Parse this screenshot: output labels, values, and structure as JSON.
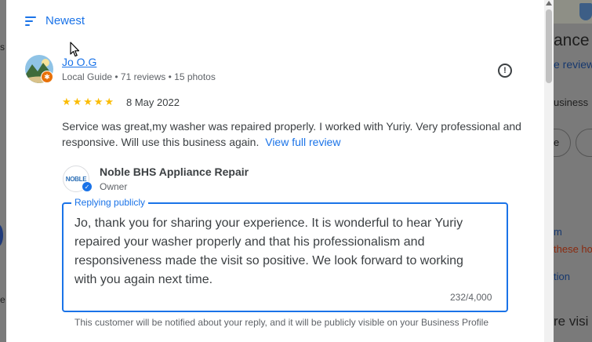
{
  "background": {
    "left_fragments": [
      "s",
      "e"
    ],
    "right_fragments": {
      "heading": "ance",
      "reviews_link": "e review",
      "category": "usiness",
      "pill_label": "e",
      "hours_link": "m",
      "hours_warning": "these ho",
      "directions": "tion",
      "visit": "re visi"
    }
  },
  "sort": {
    "label": "Newest",
    "icon": "sort-icon"
  },
  "review": {
    "reviewer_name": "Jo O.G",
    "reviewer_meta": "Local Guide • 71 reviews • 15 photos",
    "rating": 5,
    "stars": [
      "★",
      "★",
      "★",
      "★",
      "★"
    ],
    "date": "8 May 2022",
    "text": "Service was great,my washer was repaired properly. I worked with Yuriy. Very professional and responsive. Will use this business again.",
    "view_full_label": "View full review"
  },
  "owner": {
    "logo_text": "NOBLE",
    "business_name": "Noble BHS Appliance Repair",
    "role": "Owner"
  },
  "reply": {
    "label": "Replying publicly",
    "text": "Jo, thank you for sharing your experience. It is wonderful to hear Yuriy repaired your washer properly and that his professionalism and responsiveness made the visit so positive. We look forward to working with you again next time.",
    "char_count": "232/4,000",
    "notice": "This customer will be notified about your reply, and it will be publicly visible on your Business Profile"
  },
  "colors": {
    "accent": "#1a73e8",
    "star": "#fbbc04",
    "local_guide_badge": "#e8710a",
    "overlay": "#7a7a7a"
  }
}
